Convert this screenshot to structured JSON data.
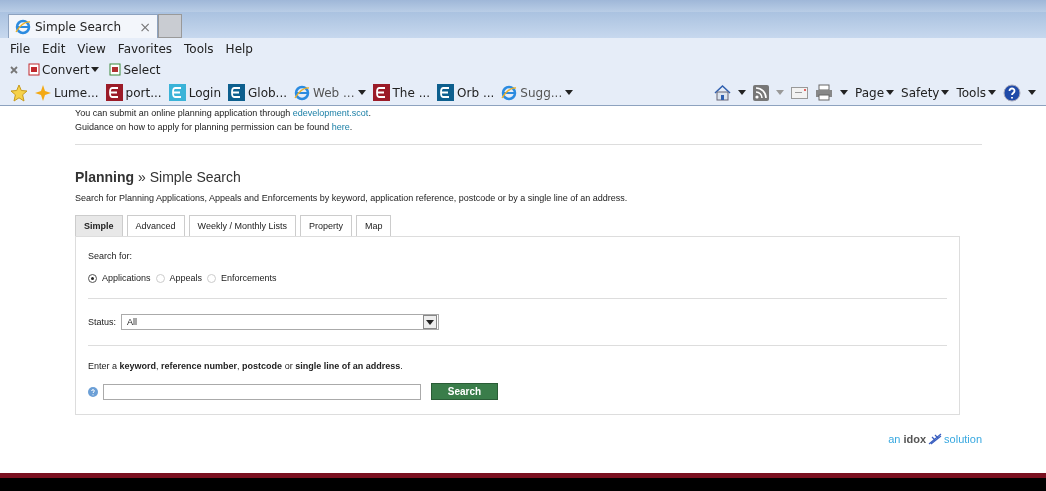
{
  "browser": {
    "tab": {
      "title": "Simple Search",
      "close": "×"
    },
    "menu": [
      "File",
      "Edit",
      "View",
      "Favorites",
      "Tools",
      "Help"
    ],
    "command_bar": [
      {
        "label": "Convert",
        "dropdown": true
      },
      {
        "label": "Select",
        "dropdown": false
      }
    ],
    "favorites": [
      {
        "label": "Lume...",
        "kind": "spark",
        "dropdown": false
      },
      {
        "label": "port...",
        "kind": "red",
        "dropdown": false
      },
      {
        "label": "Login",
        "kind": "light",
        "dropdown": false
      },
      {
        "label": "Glob...",
        "kind": "blue",
        "dropdown": false
      },
      {
        "label": "Web ...",
        "kind": "ie",
        "dropdown": true
      },
      {
        "label": "The ...",
        "kind": "red",
        "dropdown": false
      },
      {
        "label": "Orb ...",
        "kind": "blue",
        "dropdown": false
      },
      {
        "label": "Sugg...",
        "kind": "ie",
        "dropdown": true
      }
    ],
    "tools": [
      {
        "label": "Page"
      },
      {
        "label": "Safety"
      },
      {
        "label": "Tools"
      }
    ]
  },
  "page": {
    "notices": [
      {
        "text": "You can submit an online planning application through ",
        "link": "edevelopment.scot",
        "after": "."
      },
      {
        "text": "Guidance on how to apply for planning permission can be found ",
        "link": "here",
        "after": "."
      }
    ],
    "heading": {
      "section": "Planning",
      "separator": "»",
      "title": "Simple Search"
    },
    "description": "Search for Planning Applications, Appeals and Enforcements by keyword, application reference, postcode or by a single line of an address.",
    "tabs": [
      {
        "label": "Simple",
        "selected": true
      },
      {
        "label": "Advanced",
        "selected": false
      },
      {
        "label": "Weekly / Monthly Lists",
        "selected": false
      },
      {
        "label": "Property",
        "selected": false
      },
      {
        "label": "Map",
        "selected": false
      }
    ],
    "search_for": {
      "label": "Search for:",
      "options": [
        {
          "label": "Applications",
          "selected": true
        },
        {
          "label": "Appeals",
          "selected": false
        },
        {
          "label": "Enforcements",
          "selected": false
        }
      ]
    },
    "status": {
      "label": "Status:",
      "value": "All"
    },
    "keyword_prompt": "Enter a **keyword**, **reference number**, **postcode** or **single line of an address**.",
    "search_button": "Search",
    "brand": {
      "prefix": "an",
      "name": "idox",
      "suffix": "solution"
    }
  }
}
